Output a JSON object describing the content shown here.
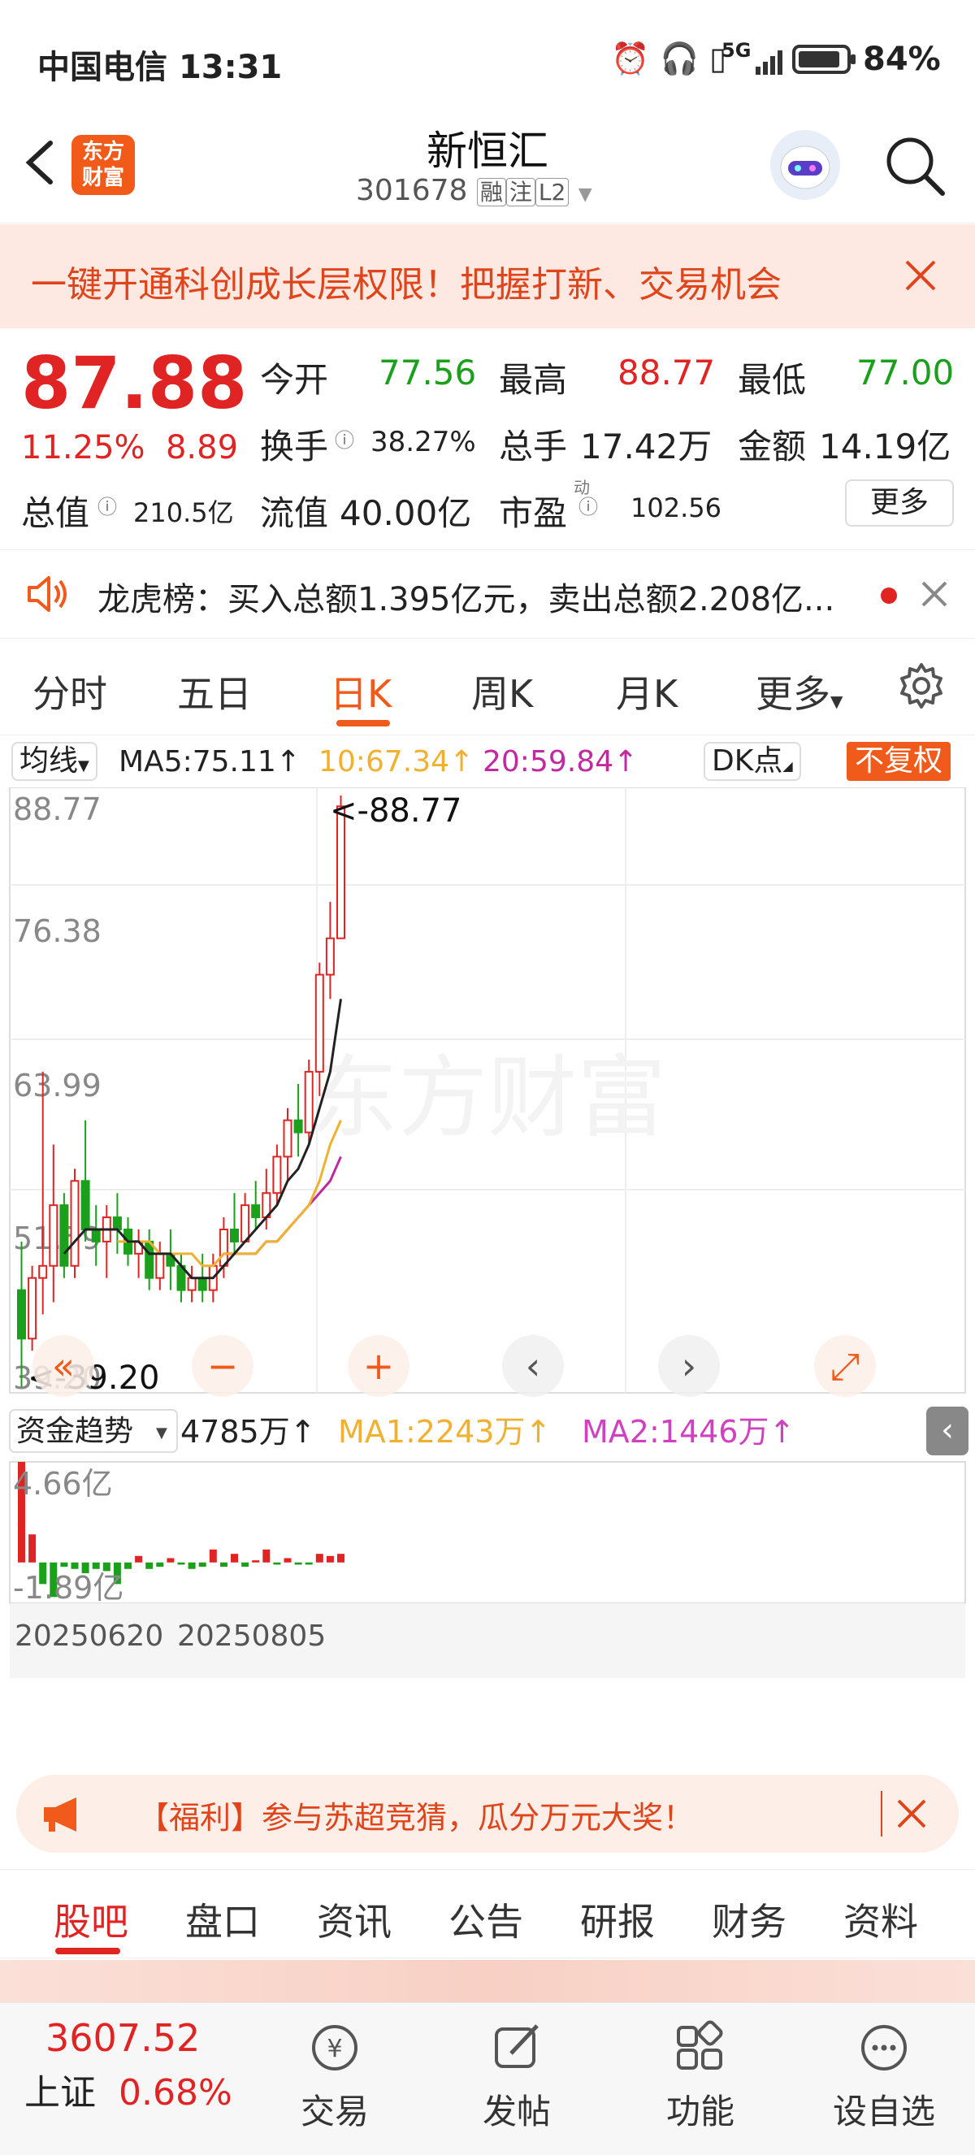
{
  "status": {
    "carrier": "中国电信",
    "time": "13:31",
    "battery": "84%",
    "net": "5G"
  },
  "header": {
    "title": "新恒汇",
    "code": "301678",
    "tags": [
      "融",
      "注",
      "L2"
    ],
    "logo_text": "东方\n财富"
  },
  "banner": {
    "text": "一键开通科创成长层权限！把握打新、交易机会"
  },
  "quote": {
    "price": "87.88",
    "change_pct": "11.25%",
    "change": "8.89",
    "open_label": "今开",
    "open": "77.56",
    "high_label": "最高",
    "high": "88.77",
    "low_label": "最低",
    "low": "77.00",
    "turnover_label": "换手",
    "turnover": "38.27%",
    "volume_label": "总手",
    "volume": "17.42万",
    "amount_label": "金额",
    "amount": "14.19亿",
    "mktcap_label": "总值",
    "mktcap": "210.5亿",
    "float_label": "流值",
    "float": "40.00亿",
    "pe_label": "市盈",
    "pe_sup": "动",
    "pe": "102.56",
    "more": "更多"
  },
  "notice": {
    "text": "龙虎榜：买入总额1.395亿元，卖出总额2.208亿..."
  },
  "chart_tabs": [
    "分时",
    "五日",
    "日K",
    "周K",
    "月K",
    "更多"
  ],
  "active_chart_tab": "日K",
  "ma_bar": {
    "selector": "均线",
    "ma5": "MA5:75.11↑",
    "ma10": "10:67.34↑",
    "ma20": "20:59.84↑",
    "dk": "DK点",
    "fq": "不复权"
  },
  "price_axis": [
    "88.77",
    "76.38",
    "63.99",
    "51.59",
    "39.20"
  ],
  "max_marker": "<-88.77",
  "min_marker": "<-39.20",
  "watermark": "东方财富",
  "fund_bar": {
    "selector": "资金趋势",
    "value": "4785万↑",
    "ma1": "MA1:2243万↑",
    "ma2": "MA2:1446万↑"
  },
  "fund_axis": [
    "4.66亿",
    "-1.89亿"
  ],
  "dates": [
    "20250620",
    "20250805"
  ],
  "promo": {
    "text": "【福利】参与苏超竞猜，瓜分万元大奖！"
  },
  "bottom_tabs": [
    "股吧",
    "盘口",
    "资讯",
    "公告",
    "研报",
    "财务",
    "资料"
  ],
  "active_bottom_tab": "股吧",
  "index": {
    "value": "3607.52",
    "name": "上证",
    "pct": "0.68%"
  },
  "nav": [
    {
      "label": "交易"
    },
    {
      "label": "发帖"
    },
    {
      "label": "功能"
    },
    {
      "label": "设自选"
    }
  ],
  "colors": {
    "up": "#e02424",
    "down": "#1aa01a",
    "accent": "#f05a1a",
    "ma5": "#222222",
    "ma10": "#f0b030",
    "ma20": "#c02aa0"
  },
  "chart_data": {
    "type": "candlestick",
    "ylim": [
      39.2,
      88.77
    ],
    "candles": [
      [
        48,
        52,
        40,
        44
      ],
      [
        44,
        50,
        43,
        49
      ],
      [
        49,
        66,
        46,
        50
      ],
      [
        50,
        60,
        47,
        55
      ],
      [
        55,
        56,
        49,
        50
      ],
      [
        50,
        58,
        49,
        57
      ],
      [
        57,
        62,
        52,
        53
      ],
      [
        53,
        55,
        50,
        52
      ],
      [
        52,
        55,
        49,
        54
      ],
      [
        54,
        56,
        51,
        53
      ],
      [
        53,
        54,
        50,
        51
      ],
      [
        51,
        53,
        49,
        52
      ],
      [
        52,
        53,
        48,
        49
      ],
      [
        49,
        52,
        48,
        51
      ],
      [
        51,
        53,
        48,
        50
      ],
      [
        50,
        51,
        47,
        48
      ],
      [
        48,
        50,
        47,
        49
      ],
      [
        49,
        51,
        47,
        48
      ],
      [
        48,
        51,
        47,
        50
      ],
      [
        50,
        54,
        49,
        53
      ],
      [
        53,
        56,
        51,
        52
      ],
      [
        52,
        56,
        52,
        55
      ],
      [
        55,
        57,
        53,
        54
      ],
      [
        54,
        58,
        53,
        56
      ],
      [
        56,
        60,
        55,
        59
      ],
      [
        59,
        63,
        57,
        62
      ],
      [
        62,
        65,
        59,
        61
      ],
      [
        61,
        67,
        60,
        66
      ],
      [
        66,
        75,
        64,
        74
      ],
      [
        74,
        80,
        72,
        77
      ],
      [
        77,
        88.77,
        77,
        87.88
      ]
    ],
    "ma5": [
      null,
      null,
      null,
      null,
      51,
      52,
      53,
      53,
      53,
      53,
      52,
      52,
      51,
      51,
      51,
      50,
      49,
      49,
      49,
      50,
      51,
      52,
      53,
      54,
      55,
      57,
      58,
      60,
      63,
      66,
      72
    ],
    "ma10": [
      null,
      null,
      null,
      null,
      null,
      null,
      null,
      null,
      null,
      52,
      52,
      52,
      52,
      51,
      51,
      51,
      51,
      50,
      50,
      51,
      51,
      51,
      51,
      52,
      52,
      53,
      54,
      55,
      57,
      60,
      62
    ],
    "ma20": [
      null,
      null,
      null,
      null,
      null,
      null,
      null,
      null,
      null,
      null,
      null,
      null,
      null,
      null,
      null,
      null,
      null,
      null,
      null,
      51,
      51,
      51,
      51,
      52,
      52,
      53,
      54,
      55,
      56,
      57,
      59
    ],
    "fund_ylim": [
      -1.89,
      4.66
    ],
    "fund": [
      4.66,
      1.3,
      -1.0,
      -1.6,
      -0.2,
      -0.3,
      -0.5,
      -0.3,
      -0.4,
      -1.0,
      -0.3,
      0.3,
      -0.3,
      -0.2,
      0.2,
      -0.1,
      -0.3,
      -0.2,
      0.6,
      -0.2,
      0.4,
      -0.2,
      0.1,
      0.6,
      -0.1,
      0.2,
      -0.1,
      -0.1,
      0.4,
      0.3,
      0.4
    ]
  }
}
